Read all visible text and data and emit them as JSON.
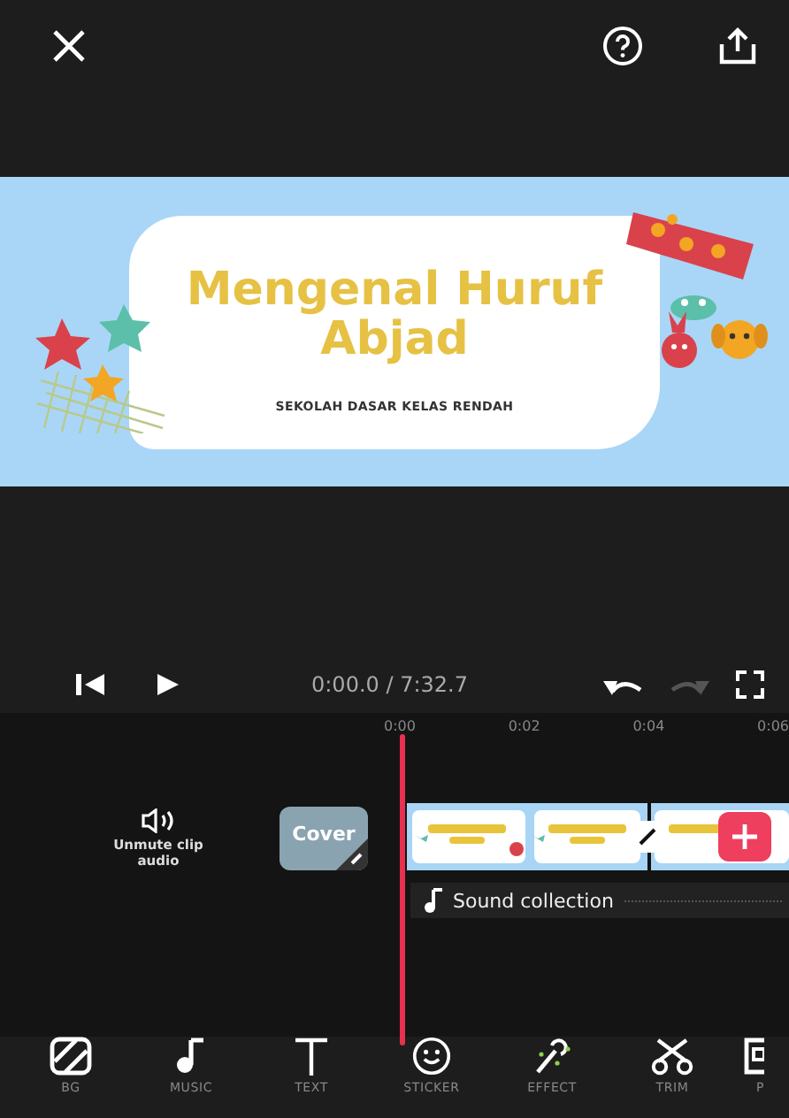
{
  "slide": {
    "title": "Mengenal Huruf Abjad",
    "subtitle": "SEKOLAH DASAR KELAS RENDAH"
  },
  "playback": {
    "time": "0:00.0 / 7:32.7",
    "playing": false,
    "redo_disabled": true
  },
  "ruler": [
    "0:00",
    "0:02",
    "0:04",
    "0:06"
  ],
  "clip_audio": {
    "label": "Unmute clip audio",
    "muted": true
  },
  "cover": {
    "label": "Cover"
  },
  "sound_track": {
    "label": "Sound collection"
  },
  "tools": [
    {
      "label": "BG",
      "kind": "bg"
    },
    {
      "label": "MUSIC",
      "kind": "music"
    },
    {
      "label": "TEXT",
      "kind": "text"
    },
    {
      "label": "STICKER",
      "kind": "sticker"
    },
    {
      "label": "EFFECT",
      "kind": "effect"
    },
    {
      "label": "TRIM",
      "kind": "trim"
    },
    {
      "label": "P",
      "kind": "frame"
    }
  ]
}
